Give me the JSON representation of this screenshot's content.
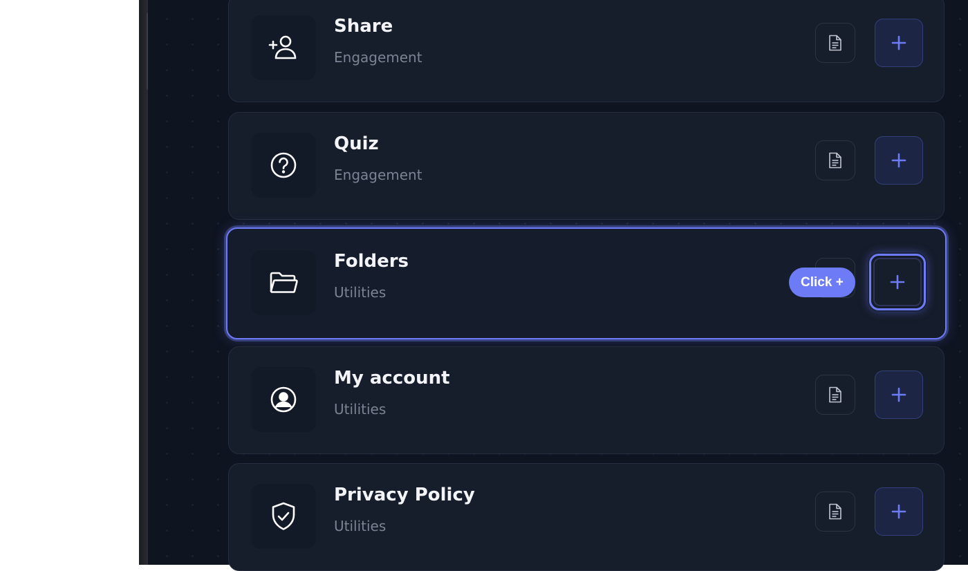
{
  "colors": {
    "accent": "#6d7cf6",
    "card_background": "#161d2b",
    "page_background": "#0e1420",
    "subtitle_text": "#7b8394"
  },
  "items": [
    {
      "title": "Share",
      "category": "Engagement",
      "icon": "add-user-icon",
      "active": false
    },
    {
      "title": "Quiz",
      "category": "Engagement",
      "icon": "question-circle-icon",
      "active": false
    },
    {
      "title": "Folders",
      "category": "Utilities",
      "icon": "folder-open-icon",
      "active": true
    },
    {
      "title": "My account",
      "category": "Utilities",
      "icon": "user-circle-icon",
      "active": false
    },
    {
      "title": "Privacy Policy",
      "category": "Utilities",
      "icon": "shield-check-icon",
      "active": false
    }
  ],
  "tooltip": {
    "text": "Click +"
  },
  "action_icons": {
    "details": "document-icon",
    "add": "plus-icon"
  }
}
